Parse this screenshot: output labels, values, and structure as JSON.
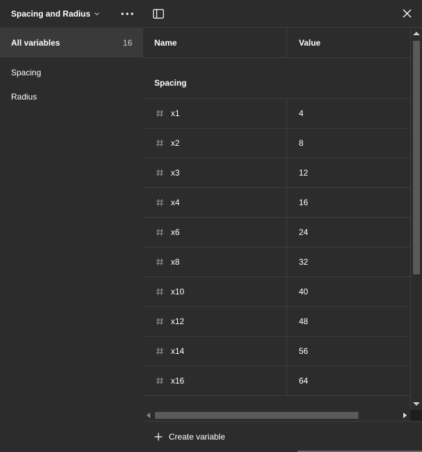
{
  "sidebar": {
    "collection_title": "Spacing and Radius",
    "items": [
      {
        "label": "All variables",
        "count": "16",
        "active": true
      },
      {
        "label": "Spacing",
        "count": ""
      },
      {
        "label": "Radius",
        "count": ""
      }
    ]
  },
  "table": {
    "columns": {
      "name": "Name",
      "value": "Value"
    },
    "group": "Spacing",
    "rows": [
      {
        "name": "x1",
        "value": "4"
      },
      {
        "name": "x2",
        "value": "8"
      },
      {
        "name": "x3",
        "value": "12"
      },
      {
        "name": "x4",
        "value": "16"
      },
      {
        "name": "x6",
        "value": "24"
      },
      {
        "name": "x8",
        "value": "32"
      },
      {
        "name": "x10",
        "value": "40"
      },
      {
        "name": "x12",
        "value": "48"
      },
      {
        "name": "x14",
        "value": "56"
      },
      {
        "name": "x16",
        "value": "64"
      }
    ]
  },
  "footer": {
    "create_label": "Create variable"
  },
  "icons": {
    "chevron": "chevron-down-icon",
    "more": "more-icon",
    "sidebar_toggle": "sidebar-toggle-icon",
    "close": "close-icon",
    "number": "hash-icon",
    "add": "plus-icon"
  },
  "colors": {
    "background": "#2c2c2c",
    "active": "#3a3a3a",
    "border": "#3d3d3d",
    "scroll_thumb": "#5a5a5a"
  }
}
